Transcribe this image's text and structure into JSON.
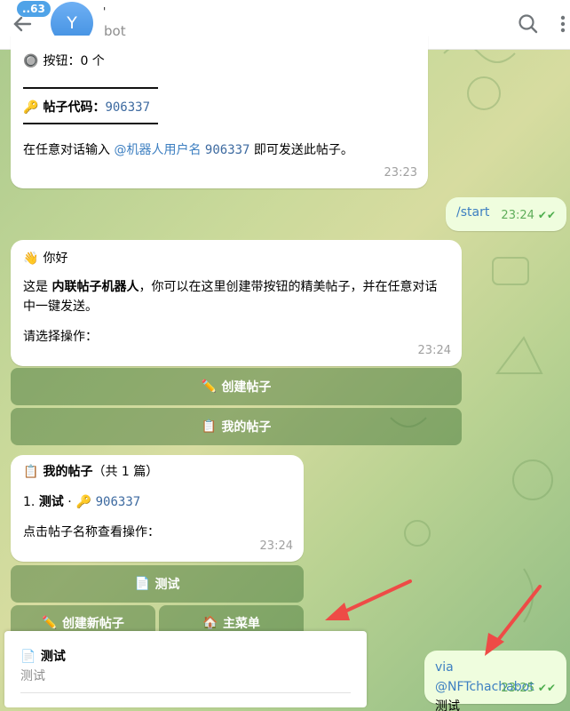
{
  "header": {
    "back_badge": "..63",
    "avatar_letter": "Y",
    "name": "'",
    "subtitle": "bot"
  },
  "msg1": {
    "buttons_line": "按钮：0 个",
    "code_label": "帖子代码：",
    "code_value": "906337",
    "hint_pre": "在任意对话输入 ",
    "hint_link": "@机器人用户名",
    "hint_code": "906337",
    "hint_post": " 即可发送此帖子。",
    "time": "23:23"
  },
  "msg_start": {
    "text": "/start",
    "time": "23:24"
  },
  "msg2": {
    "greeting": "你好",
    "intro_pre": "这是 ",
    "intro_bold": "内联帖子机器人",
    "intro_post": "，你可以在这里创建带按钮的精美帖子，并在任意对话中一键发送。",
    "prompt": "请选择操作：",
    "time": "23:24",
    "btn_create": "创建帖子",
    "btn_mine": "我的帖子"
  },
  "msg3": {
    "title": "我的帖子",
    "count": "（共 1 篇）",
    "item_index": "1.",
    "item_title": "测试",
    "item_sep": "·",
    "item_code": "906337",
    "hint": "点击帖子名称查看操作：",
    "time": "23:24",
    "btn_test": "测试",
    "btn_new": "创建新帖子",
    "btn_menu": "主菜单"
  },
  "inline_result": {
    "title": "测试",
    "desc": "测试"
  },
  "msg_via": {
    "via": "via ",
    "bot": "@NFTchachabot",
    "text": "测试",
    "time": "23:25"
  },
  "colors": {
    "accent": "#3d7fc1",
    "arrow": "#ee4b46",
    "outgoing": "#effdde"
  }
}
